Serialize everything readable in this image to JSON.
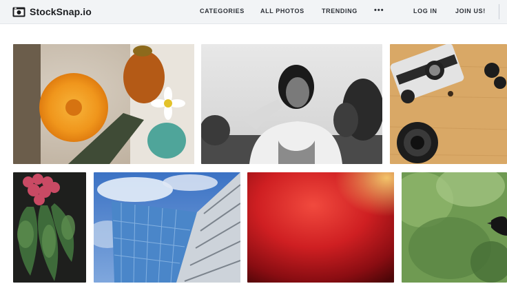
{
  "brand": {
    "name": "StockSnap.io",
    "icon": "camera-icon"
  },
  "nav": {
    "categories": "CATEGORIES",
    "all_photos": "ALL PHOTOS",
    "trending": "TRENDING",
    "more": "•••",
    "login": "LOG IN",
    "join": "JOIN US!"
  },
  "colors": {
    "nav_bg": "#f2f4f6",
    "text": "#2b2f36"
  },
  "photos": [
    {
      "subject": "orange dahlia and glass bottles"
    },
    {
      "subject": "black and white portrait of a woman"
    },
    {
      "subject": "vintage camera and lens on wooden table"
    },
    {
      "subject": "radishes with leaves on dark background"
    },
    {
      "subject": "glass office building against blue sky"
    },
    {
      "subject": "red abstract blur"
    },
    {
      "subject": "bird in green foliage"
    }
  ]
}
